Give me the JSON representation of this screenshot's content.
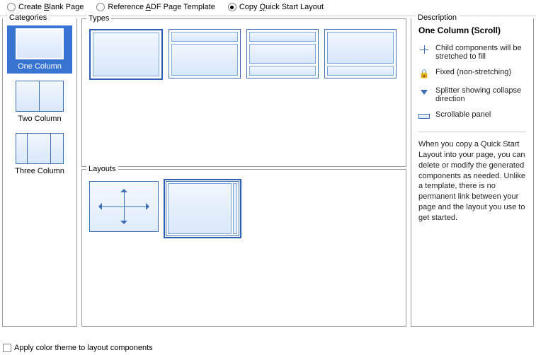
{
  "radios": {
    "blank": "Create ",
    "blank_u": "B",
    "blank2": "lank Page",
    "ref1": "Reference ",
    "ref_u": "A",
    "ref2": "DF Page Template",
    "copy1": "Copy ",
    "copy_u": "Q",
    "copy2": "uick Start Layout"
  },
  "labels": {
    "categories": "Categories",
    "types": "Types",
    "layouts": "Layouts",
    "description": "Description",
    "applyTheme": "Apply color theme to layout components"
  },
  "categories": {
    "one": "One Column",
    "two": "Two Column",
    "three": "Three Column"
  },
  "desc": {
    "title": "One Column (Scroll)",
    "legend": {
      "stretch": "Child components will be stretched to fill",
      "fixed": "Fixed (non-stretching)",
      "splitter": "Splitter showing collapse direction",
      "scroll": "Scrollable panel"
    },
    "para": "When you copy a Quick Start Layout into your page, you can delete or modify the generated components as needed. Unlike a template, there is no permanent link between your page and the layout you use to get started."
  }
}
